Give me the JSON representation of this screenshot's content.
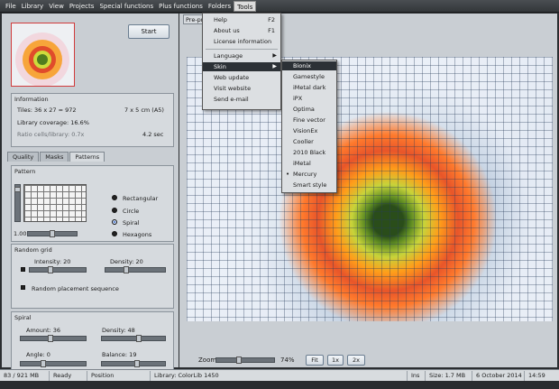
{
  "menubar": [
    "File",
    "Library",
    "View",
    "Projects",
    "Special functions",
    "Plus functions",
    "Folders",
    "Tools"
  ],
  "start_label": "Start",
  "information": {
    "title": "Information",
    "tiles": "Tiles: 36 x 27 = 972",
    "size": "7 x 5 cm  (A5)",
    "coverage": "Library coverage: 16.6%",
    "ratio": "Ratio cells/library: 0.7x",
    "time": "4.2 sec"
  },
  "tabs": [
    "Quality",
    "Masks",
    "Patterns"
  ],
  "pattern": {
    "title": "Pattern",
    "options": [
      "Rectangular",
      "Circle",
      "Spiral",
      "Hexagons"
    ],
    "value": "1.00"
  },
  "random_grid": {
    "title": "Random grid",
    "intensity": "Intensity: 20",
    "density": "Density: 20",
    "placement": "Random placement sequence"
  },
  "spiral": {
    "title": "Spiral",
    "amount": "Amount: 36",
    "density": "Density: 48",
    "angle": "Angle: 0",
    "balance": "Balance: 19"
  },
  "preview_tab": "Pre-pr",
  "zoom": {
    "label": "Zoom",
    "value": "74%",
    "buttons": [
      "Fit",
      "1x",
      "2x"
    ]
  },
  "status": {
    "memory": "83 / 921 MB",
    "state": "Ready",
    "position": "Position",
    "library": "Library: ColorLib 1450",
    "ins": "Ins",
    "size": "Size: 1.7 MB",
    "date": "6 October 2014",
    "time": "14:59"
  },
  "tools_menu": {
    "help": "Help",
    "help_key": "F2",
    "about": "About us",
    "about_key": "F1",
    "license": "License information",
    "language": "Language",
    "skin": "Skin",
    "web_update": "Web update",
    "visit": "Visit website",
    "email": "Send e-mail"
  },
  "skin_menu": [
    "Bionix",
    "Gamestyle",
    "iMetal dark",
    "iPX",
    "Optima",
    "Fine vector",
    "VisionEx",
    "Cooller",
    "2010 Black",
    "iMetal",
    "Mercury",
    "Smart style"
  ],
  "skin_selected": "Mercury"
}
